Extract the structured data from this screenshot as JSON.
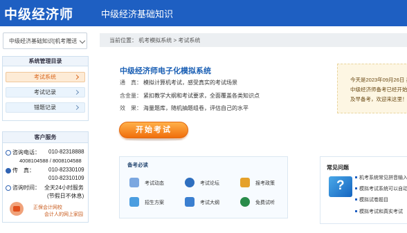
{
  "header": {
    "brand": "中级经济师",
    "subject": "中级经济基础知识"
  },
  "subject_select": {
    "value": "中级经济基础知识[机考赠送"
  },
  "menu": {
    "title": "系统管理目录",
    "items": [
      {
        "label": "考试系统",
        "active": true
      },
      {
        "label": "考试记录",
        "active": false
      },
      {
        "label": "错题记录",
        "active": false
      }
    ]
  },
  "service": {
    "title": "客户服务",
    "phone_label": "咨询电话：",
    "phone1": "010-82318888",
    "phone2": "4008104588 / 8008104588",
    "fax_label": "传　真：",
    "fax1": "010-82330109",
    "fax2": "010-82310109",
    "hours_label": "咨询时间：",
    "hours1": "全天24小时服务",
    "hours2": "(节假日不休息)",
    "brand_name": "正保会计网校",
    "brand_slogan": "会计人的网上家园"
  },
  "breadcrumb": {
    "text": "当前位置：  机考模拟系统  >  考试系统"
  },
  "intro": {
    "title": "中级经济师电子化模拟系统",
    "features": [
      {
        "k": "通　真：",
        "v": "模拟计算机考试，感受真实的考试场景"
      },
      {
        "k": "含金量：",
        "v": "紧扣教学大纲和考试要求，全面覆盖各类知识点"
      },
      {
        "k": "效　果：",
        "v": "海量题库，随机抽题组卷，评估自己的水平"
      }
    ],
    "start_label": "开始考试"
  },
  "notice": {
    "line1": "今天是2023年09月26日 星",
    "line2": "中级经济师备考已经开始",
    "line3": "及早备考，欢迎来这里！"
  },
  "prep": {
    "title": "备考必读",
    "items": [
      {
        "label": "考试动态",
        "color": "#5b8fd6"
      },
      {
        "label": "考试论坛",
        "color": "#2f6fbf"
      },
      {
        "label": "报考政策",
        "color": "#e5a12a"
      },
      {
        "label": "招生方案",
        "color": "#4a9de0"
      },
      {
        "label": "考试大纲",
        "color": "#3b7fd0"
      },
      {
        "label": "免费试听",
        "color": "#2a8c4a"
      }
    ]
  },
  "faq": {
    "title": "常见问题",
    "items": [
      {
        "label": "机考系统常见拼音输入"
      },
      {
        "label": "模拟考试系统可以自动"
      },
      {
        "label": "模拟试卷题目"
      },
      {
        "label": "模拟考试和真实考试"
      }
    ]
  }
}
